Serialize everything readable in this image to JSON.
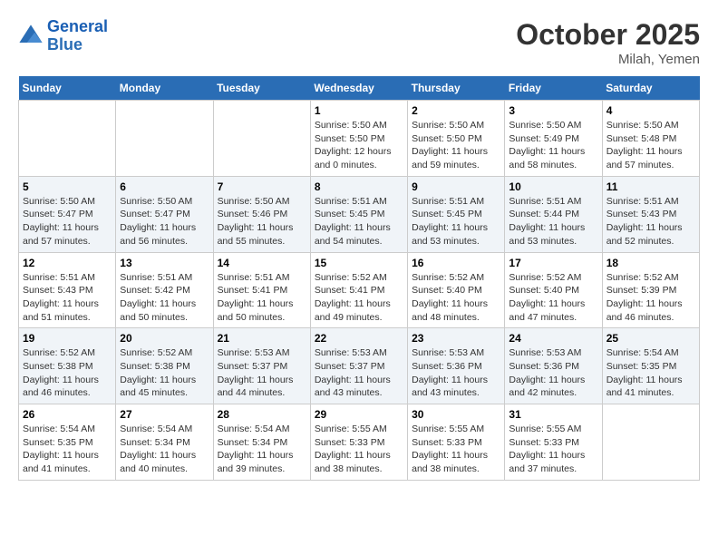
{
  "header": {
    "logo_line1": "General",
    "logo_line2": "Blue",
    "month_title": "October 2025",
    "location": "Milah, Yemen"
  },
  "weekdays": [
    "Sunday",
    "Monday",
    "Tuesday",
    "Wednesday",
    "Thursday",
    "Friday",
    "Saturday"
  ],
  "weeks": [
    [
      {
        "day": "",
        "sunrise": "",
        "sunset": "",
        "daylight": ""
      },
      {
        "day": "",
        "sunrise": "",
        "sunset": "",
        "daylight": ""
      },
      {
        "day": "",
        "sunrise": "",
        "sunset": "",
        "daylight": ""
      },
      {
        "day": "1",
        "sunrise": "Sunrise: 5:50 AM",
        "sunset": "Sunset: 5:50 PM",
        "daylight": "Daylight: 12 hours and 0 minutes."
      },
      {
        "day": "2",
        "sunrise": "Sunrise: 5:50 AM",
        "sunset": "Sunset: 5:50 PM",
        "daylight": "Daylight: 11 hours and 59 minutes."
      },
      {
        "day": "3",
        "sunrise": "Sunrise: 5:50 AM",
        "sunset": "Sunset: 5:49 PM",
        "daylight": "Daylight: 11 hours and 58 minutes."
      },
      {
        "day": "4",
        "sunrise": "Sunrise: 5:50 AM",
        "sunset": "Sunset: 5:48 PM",
        "daylight": "Daylight: 11 hours and 57 minutes."
      }
    ],
    [
      {
        "day": "5",
        "sunrise": "Sunrise: 5:50 AM",
        "sunset": "Sunset: 5:47 PM",
        "daylight": "Daylight: 11 hours and 57 minutes."
      },
      {
        "day": "6",
        "sunrise": "Sunrise: 5:50 AM",
        "sunset": "Sunset: 5:47 PM",
        "daylight": "Daylight: 11 hours and 56 minutes."
      },
      {
        "day": "7",
        "sunrise": "Sunrise: 5:50 AM",
        "sunset": "Sunset: 5:46 PM",
        "daylight": "Daylight: 11 hours and 55 minutes."
      },
      {
        "day": "8",
        "sunrise": "Sunrise: 5:51 AM",
        "sunset": "Sunset: 5:45 PM",
        "daylight": "Daylight: 11 hours and 54 minutes."
      },
      {
        "day": "9",
        "sunrise": "Sunrise: 5:51 AM",
        "sunset": "Sunset: 5:45 PM",
        "daylight": "Daylight: 11 hours and 53 minutes."
      },
      {
        "day": "10",
        "sunrise": "Sunrise: 5:51 AM",
        "sunset": "Sunset: 5:44 PM",
        "daylight": "Daylight: 11 hours and 53 minutes."
      },
      {
        "day": "11",
        "sunrise": "Sunrise: 5:51 AM",
        "sunset": "Sunset: 5:43 PM",
        "daylight": "Daylight: 11 hours and 52 minutes."
      }
    ],
    [
      {
        "day": "12",
        "sunrise": "Sunrise: 5:51 AM",
        "sunset": "Sunset: 5:43 PM",
        "daylight": "Daylight: 11 hours and 51 minutes."
      },
      {
        "day": "13",
        "sunrise": "Sunrise: 5:51 AM",
        "sunset": "Sunset: 5:42 PM",
        "daylight": "Daylight: 11 hours and 50 minutes."
      },
      {
        "day": "14",
        "sunrise": "Sunrise: 5:51 AM",
        "sunset": "Sunset: 5:41 PM",
        "daylight": "Daylight: 11 hours and 50 minutes."
      },
      {
        "day": "15",
        "sunrise": "Sunrise: 5:52 AM",
        "sunset": "Sunset: 5:41 PM",
        "daylight": "Daylight: 11 hours and 49 minutes."
      },
      {
        "day": "16",
        "sunrise": "Sunrise: 5:52 AM",
        "sunset": "Sunset: 5:40 PM",
        "daylight": "Daylight: 11 hours and 48 minutes."
      },
      {
        "day": "17",
        "sunrise": "Sunrise: 5:52 AM",
        "sunset": "Sunset: 5:40 PM",
        "daylight": "Daylight: 11 hours and 47 minutes."
      },
      {
        "day": "18",
        "sunrise": "Sunrise: 5:52 AM",
        "sunset": "Sunset: 5:39 PM",
        "daylight": "Daylight: 11 hours and 46 minutes."
      }
    ],
    [
      {
        "day": "19",
        "sunrise": "Sunrise: 5:52 AM",
        "sunset": "Sunset: 5:38 PM",
        "daylight": "Daylight: 11 hours and 46 minutes."
      },
      {
        "day": "20",
        "sunrise": "Sunrise: 5:52 AM",
        "sunset": "Sunset: 5:38 PM",
        "daylight": "Daylight: 11 hours and 45 minutes."
      },
      {
        "day": "21",
        "sunrise": "Sunrise: 5:53 AM",
        "sunset": "Sunset: 5:37 PM",
        "daylight": "Daylight: 11 hours and 44 minutes."
      },
      {
        "day": "22",
        "sunrise": "Sunrise: 5:53 AM",
        "sunset": "Sunset: 5:37 PM",
        "daylight": "Daylight: 11 hours and 43 minutes."
      },
      {
        "day": "23",
        "sunrise": "Sunrise: 5:53 AM",
        "sunset": "Sunset: 5:36 PM",
        "daylight": "Daylight: 11 hours and 43 minutes."
      },
      {
        "day": "24",
        "sunrise": "Sunrise: 5:53 AM",
        "sunset": "Sunset: 5:36 PM",
        "daylight": "Daylight: 11 hours and 42 minutes."
      },
      {
        "day": "25",
        "sunrise": "Sunrise: 5:54 AM",
        "sunset": "Sunset: 5:35 PM",
        "daylight": "Daylight: 11 hours and 41 minutes."
      }
    ],
    [
      {
        "day": "26",
        "sunrise": "Sunrise: 5:54 AM",
        "sunset": "Sunset: 5:35 PM",
        "daylight": "Daylight: 11 hours and 41 minutes."
      },
      {
        "day": "27",
        "sunrise": "Sunrise: 5:54 AM",
        "sunset": "Sunset: 5:34 PM",
        "daylight": "Daylight: 11 hours and 40 minutes."
      },
      {
        "day": "28",
        "sunrise": "Sunrise: 5:54 AM",
        "sunset": "Sunset: 5:34 PM",
        "daylight": "Daylight: 11 hours and 39 minutes."
      },
      {
        "day": "29",
        "sunrise": "Sunrise: 5:55 AM",
        "sunset": "Sunset: 5:33 PM",
        "daylight": "Daylight: 11 hours and 38 minutes."
      },
      {
        "day": "30",
        "sunrise": "Sunrise: 5:55 AM",
        "sunset": "Sunset: 5:33 PM",
        "daylight": "Daylight: 11 hours and 38 minutes."
      },
      {
        "day": "31",
        "sunrise": "Sunrise: 5:55 AM",
        "sunset": "Sunset: 5:33 PM",
        "daylight": "Daylight: 11 hours and 37 minutes."
      },
      {
        "day": "",
        "sunrise": "",
        "sunset": "",
        "daylight": ""
      }
    ]
  ]
}
